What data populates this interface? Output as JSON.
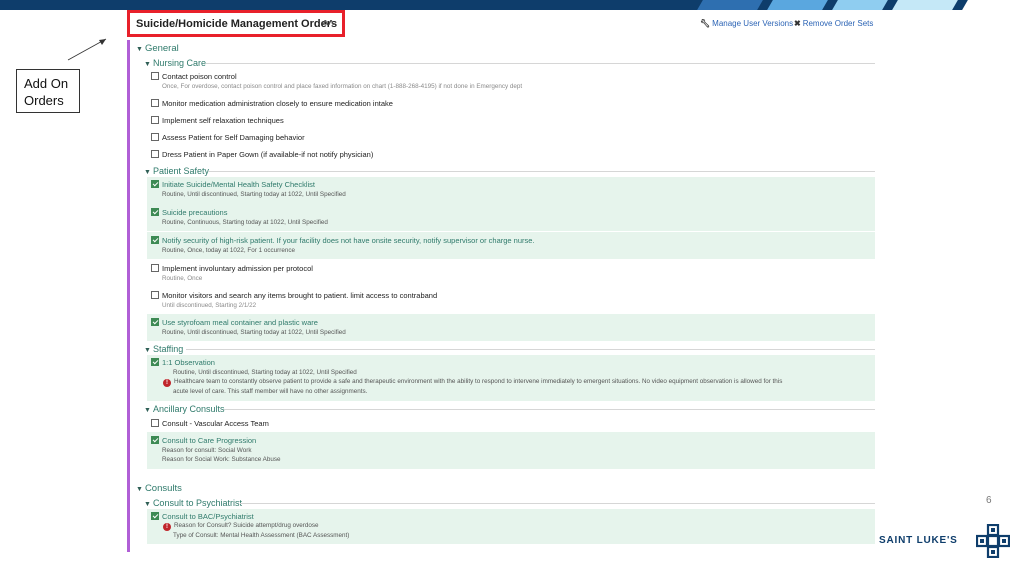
{
  "callout": {
    "text_line1": "Add On",
    "text_line2": "Orders"
  },
  "panel": {
    "title": "Suicide/Homicide Management Orders",
    "collapse_icon": "double-chevron-up-icon",
    "links": {
      "manage_versions": "Manage User Versions",
      "remove_order_sets": "Remove Order Sets"
    }
  },
  "sections": {
    "general": "General",
    "nursing_care": "Nursing Care",
    "patient_safety": "Patient Safety",
    "staffing": "Staffing",
    "ancillary_consults": "Ancillary Consults",
    "consults": "Consults",
    "consult_to_psychiatrist": "Consult to Psychiatrist"
  },
  "nursing_care": [
    {
      "name": "Contact poison control",
      "detail": "Once, For overdose, contact poison control and place faxed information on chart (1-888-268-4195) if not done in Emergency dept",
      "checked": false
    },
    {
      "name": "Monitor medication administration closely to ensure medication intake",
      "detail": "",
      "checked": false
    },
    {
      "name": "Implement self relaxation techniques",
      "detail": "",
      "checked": false
    },
    {
      "name": "Assess Patient for Self Damaging behavior",
      "detail": "",
      "checked": false
    },
    {
      "name": "Dress Patient in Paper Gown (if available-if not notify physician)",
      "detail": "",
      "checked": false
    }
  ],
  "patient_safety": [
    {
      "name": "Initiate Suicide/Mental Health Safety Checklist",
      "detail": "Routine, Until discontinued, Starting today at 1022, Until Specified",
      "checked": true
    },
    {
      "name": "Suicide precautions",
      "detail": "Routine, Continuous, Starting today at 1022, Until Specified",
      "checked": true
    },
    {
      "name": "Notify security of high-risk patient. If your facility does not have onsite security, notify supervisor or charge nurse.",
      "detail": "Routine, Once, today at 1022, For 1 occurrence",
      "checked": true
    },
    {
      "name": "Implement involuntary admission per protocol",
      "detail": "Routine, Once",
      "checked": false
    },
    {
      "name": "Monitor visitors and search any items brought to patient. limit access to contraband",
      "detail": "Until discontinued, Starting 2/1/22",
      "checked": false
    },
    {
      "name": "Use styrofoam meal container and plastic ware",
      "detail": "Routine, Until discontinued, Starting today at 1022, Until Specified",
      "checked": true
    }
  ],
  "staffing": {
    "name": "1:1 Observation",
    "detail": "Routine, Until discontinued, Starting today at 1022, Until Specified",
    "warning_line1": "Healthcare team to constantly observe patient to provide a safe and therapeutic environment with the ability to respond to intervene immediately to emergent situations. No video equipment observation is allowed for this",
    "warning_line2": "acute level of care. This staff member will have no other assignments.",
    "checked": true
  },
  "ancillary_consults": [
    {
      "name": "Consult - Vascular Access Team",
      "checked": false
    },
    {
      "name": "Consult to Care Progression",
      "detail1": "Reason for consult: Social Work",
      "detail2": "Reason for Social Work: Substance Abuse",
      "checked": true
    }
  ],
  "psychiatrist": {
    "name": "Consult to BAC/Psychiatrist",
    "warning_line1": "Reason for Consult? Suicide attempt/drug overdose",
    "warning_line2": "Type of Consult: Mental Health Assessment (BAC Assessment)",
    "checked": true
  },
  "footer": {
    "page_number": "6",
    "brand": "SAINT LUKE'S",
    "logo_icon": "saint-lukes-cross-logo-icon"
  },
  "colors": {
    "accent_green": "#2f7a6b",
    "selected_bg": "#e6f4ec",
    "side_bar": "#b05fd6",
    "title_border": "#e8202a",
    "banner": "#0e3d6b"
  }
}
